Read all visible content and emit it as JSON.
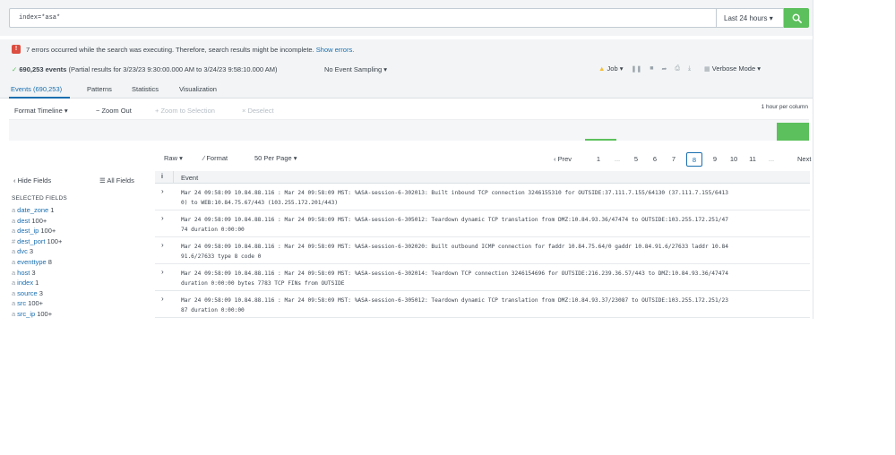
{
  "search": {
    "query": "index=*asa*",
    "time_range": "Last 24 hours ▾"
  },
  "errors": {
    "badge": "!",
    "message": "7 errors occurred while the search was executing. Therefore, search results might be incomplete.",
    "link": "Show errors."
  },
  "status": {
    "check": "✓",
    "count": "690,253 events",
    "partial": "(Partial results for 3/23/23 9:30:00.000 AM to 3/24/23 9:58:10.000 AM)",
    "sampling": "No Event Sampling ▾",
    "job": "Job ▾",
    "mode": "Verbose Mode ▾"
  },
  "tabs": [
    {
      "label": "Events (690,253)"
    },
    {
      "label": "Patterns"
    },
    {
      "label": "Statistics"
    },
    {
      "label": "Visualization"
    }
  ],
  "timeline": {
    "format": "Format Timeline ▾",
    "zoom_out": "− Zoom Out",
    "zoom_selection": "+ Zoom to Selection",
    "deselect": "× Deselect",
    "scale": "1 hour per column"
  },
  "results_toolbar": {
    "raw": "Raw ▾",
    "format": "∕ Format",
    "per_page": "50 Per Page ▾"
  },
  "pager": {
    "prev": "‹ Prev",
    "pages": [
      "1",
      "...",
      "5",
      "6",
      "7",
      "8",
      "9",
      "10",
      "11",
      "..."
    ],
    "active": "8",
    "next": "Next ›"
  },
  "sidebar": {
    "hide": "‹ Hide Fields",
    "all": "☰ All Fields",
    "heading": "SELECTED FIELDS",
    "fields": [
      {
        "type": "a",
        "name": "date_zone",
        "count": "1"
      },
      {
        "type": "a",
        "name": "dest",
        "count": "100+"
      },
      {
        "type": "a",
        "name": "dest_ip",
        "count": "100+"
      },
      {
        "type": "#",
        "name": "dest_port",
        "count": "100+"
      },
      {
        "type": "a",
        "name": "dvc",
        "count": "3"
      },
      {
        "type": "a",
        "name": "eventtype",
        "count": "8"
      },
      {
        "type": "a",
        "name": "host",
        "count": "3"
      },
      {
        "type": "a",
        "name": "index",
        "count": "1"
      },
      {
        "type": "a",
        "name": "source",
        "count": "3"
      },
      {
        "type": "a",
        "name": "src",
        "count": "100+"
      },
      {
        "type": "a",
        "name": "src_ip",
        "count": "100+"
      }
    ]
  },
  "events": {
    "info_col": "i",
    "event_col": "Event",
    "expand_icon": "›",
    "rows": [
      {
        "line1": "Mar 24 09:58:09 10.84.88.116 : Mar 24 09:58:09 MST: %ASA-session-6-302013: Built inbound TCP connection 3246155310 for OUTSIDE:37.111.7.155/64130 (37.111.7.155/6413",
        "line2": "0) to WEB:10.84.75.67/443 (103.255.172.201/443)"
      },
      {
        "line1": "Mar 24 09:58:09 10.84.88.116 : Mar 24 09:58:09 MST: %ASA-session-6-305012: Teardown dynamic TCP translation from DMZ:10.84.93.36/47474 to OUTSIDE:103.255.172.251/47",
        "line2": "74 duration 0:00:00"
      },
      {
        "line1": "Mar 24 09:58:09 10.84.88.116 : Mar 24 09:58:09 MST: %ASA-session-6-302020: Built outbound ICMP connection for faddr 10.84.75.64/0 gaddr 10.84.91.6/27633 laddr 10.84",
        "line2": "91.6/27633 type 8 code 0"
      },
      {
        "line1": "Mar 24 09:58:09 10.84.88.116 : Mar 24 09:58:09 MST: %ASA-session-6-302014: Teardown TCP connection 3246154696 for OUTSIDE:216.239.36.57/443 to DMZ:10.84.93.36/47474",
        "line2": "duration 0:00:00 bytes 7783 TCP FINs from OUTSIDE"
      },
      {
        "line1": "Mar 24 09:58:09 10.84.88.116 : Mar 24 09:58:09 MST: %ASA-session-6-305012: Teardown dynamic TCP translation from DMZ:10.84.93.37/23087 to OUTSIDE:103.255.172.251/23",
        "line2": "87 duration 0:00:00"
      }
    ]
  },
  "colors": {
    "accent": "#1a6fb0",
    "success": "#5cc05c",
    "error": "#dc4e41",
    "warning": "#f8be34"
  }
}
